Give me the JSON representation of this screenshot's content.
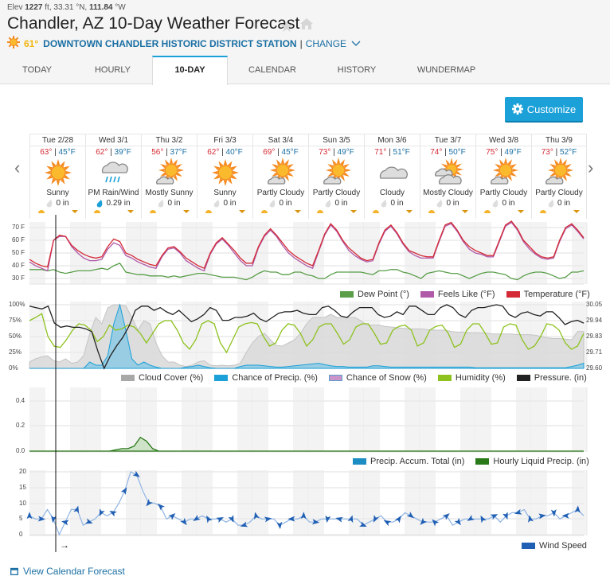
{
  "header": {
    "elev_label": "Elev",
    "elev_value": "1227",
    "elev_unit": "ft,",
    "lat": "33.31",
    "lat_unit": "°N,",
    "lon": "111.84",
    "lon_unit": "°W",
    "title": "Chandler, AZ 10-Day Weather Forecast",
    "current_temp": "61°",
    "station": "DOWNTOWN CHANDLER HISTORIC DISTRICT STATION",
    "separator": "|",
    "change_label": "CHANGE"
  },
  "tabs": [
    {
      "label": "TODAY",
      "active": false
    },
    {
      "label": "HOURLY",
      "active": false
    },
    {
      "label": "10-DAY",
      "active": true
    },
    {
      "label": "CALENDAR",
      "active": false
    },
    {
      "label": "HISTORY",
      "active": false
    },
    {
      "label": "WUNDERMAP",
      "active": false
    }
  ],
  "customize_label": "Customize",
  "days": [
    {
      "date": "Tue 2/28",
      "hi": "63°",
      "lo": "45°F",
      "icon": "sunny",
      "cond": "Sunny",
      "precip": "0 in",
      "rain": false
    },
    {
      "date": "Wed 3/1",
      "hi": "62°",
      "lo": "39°F",
      "icon": "rain",
      "cond": "PM Rain/Wind",
      "precip": "0.29 in",
      "rain": true
    },
    {
      "date": "Thu 3/2",
      "hi": "56°",
      "lo": "37°F",
      "icon": "mostly-sunny",
      "cond": "Mostly Sunny",
      "precip": "0 in",
      "rain": false
    },
    {
      "date": "Fri 3/3",
      "hi": "62°",
      "lo": "40°F",
      "icon": "sunny",
      "cond": "Sunny",
      "precip": "0 in",
      "rain": false
    },
    {
      "date": "Sat 3/4",
      "hi": "69°",
      "lo": "45°F",
      "icon": "partly-cloudy",
      "cond": "Partly Cloudy",
      "precip": "0 in",
      "rain": false
    },
    {
      "date": "Sun 3/5",
      "hi": "73°",
      "lo": "49°F",
      "icon": "partly-cloudy",
      "cond": "Partly Cloudy",
      "precip": "0 in",
      "rain": false
    },
    {
      "date": "Mon 3/6",
      "hi": "71°",
      "lo": "51°F",
      "icon": "cloudy",
      "cond": "Cloudy",
      "precip": "0 in",
      "rain": false
    },
    {
      "date": "Tue 3/7",
      "hi": "74°",
      "lo": "50°F",
      "icon": "mostly-cloudy",
      "cond": "Mostly Cloudy",
      "precip": "0 in",
      "rain": false
    },
    {
      "date": "Wed 3/8",
      "hi": "75°",
      "lo": "49°F",
      "icon": "partly-cloudy",
      "cond": "Partly Cloudy",
      "precip": "0 in",
      "rain": false
    },
    {
      "date": "Thu 3/9",
      "hi": "73°",
      "lo": "52°F",
      "icon": "partly-cloudy",
      "cond": "Partly Cloudy",
      "precip": "0 in",
      "rain": false
    }
  ],
  "colors": {
    "accent": "#1ba0d8",
    "link": "#1a6fa3",
    "temperature": "#d42a36",
    "feels_like": "#b05aa8",
    "dew_point": "#5a9e4a",
    "cloud_cover": "#a8a8a8",
    "precip_chance": "#1ba0d8",
    "snow_chance": "#c994c7",
    "humidity": "#8dc21f",
    "pressure": "#222222",
    "precip_accum": "#1b8dc2",
    "hourly_precip": "#2a7a1a",
    "wind": "#1f5fb4"
  },
  "chart_data": [
    {
      "type": "line",
      "name": "temperature-chart",
      "y_ticks": [
        "70 F",
        "60 F",
        "50 F",
        "40 F",
        "30 F"
      ],
      "ylim": [
        27,
        72
      ],
      "x_days": 10,
      "series": [
        {
          "name": "Temperature (°F)",
          "values": [
            45,
            42,
            40,
            39,
            60,
            64,
            63,
            56,
            52,
            49,
            47,
            46,
            47,
            55,
            61,
            59,
            50,
            48,
            45,
            43,
            41,
            40,
            48,
            54,
            55,
            51,
            46,
            43,
            40,
            38,
            50,
            58,
            62,
            57,
            52,
            46,
            42,
            42,
            55,
            64,
            69,
            64,
            58,
            52,
            48,
            45,
            42,
            40,
            52,
            65,
            73,
            68,
            60,
            54,
            50,
            46,
            44,
            45,
            58,
            68,
            72,
            66,
            58,
            52,
            50,
            48,
            47,
            47,
            60,
            72,
            74,
            68,
            60,
            55,
            52,
            50,
            48,
            48,
            60,
            72,
            75,
            69,
            60,
            55,
            50,
            47,
            46,
            47,
            60,
            70,
            73,
            68,
            62
          ]
        },
        {
          "name": "Feels Like (°F)",
          "values": [
            43,
            40,
            38,
            36,
            60,
            63,
            63,
            55,
            50,
            46,
            44,
            44,
            45,
            53,
            58,
            56,
            48,
            46,
            43,
            41,
            39,
            38,
            47,
            53,
            54,
            50,
            44,
            41,
            38,
            36,
            49,
            57,
            61,
            56,
            50,
            44,
            40,
            40,
            54,
            63,
            68,
            63,
            56,
            50,
            46,
            43,
            40,
            38,
            51,
            64,
            72,
            67,
            59,
            52,
            48,
            45,
            43,
            44,
            57,
            67,
            71,
            65,
            57,
            51,
            48,
            46,
            46,
            46,
            59,
            71,
            73,
            67,
            59,
            53,
            50,
            49,
            47,
            47,
            59,
            71,
            74,
            68,
            59,
            53,
            49,
            46,
            45,
            46,
            59,
            69,
            72,
            67,
            61
          ]
        },
        {
          "name": "Dew Point (°)",
          "values": [
            37,
            37,
            37,
            36,
            37,
            35,
            34,
            35,
            36,
            36,
            36,
            37,
            38,
            37,
            40,
            42,
            35,
            34,
            33,
            33,
            32,
            32,
            32,
            31,
            32,
            31,
            32,
            33,
            34,
            34,
            33,
            32,
            31,
            31,
            31,
            30,
            29,
            31,
            34,
            36,
            35,
            35,
            33,
            33,
            35,
            35,
            33,
            32,
            30,
            30,
            33,
            35,
            35,
            35,
            35,
            35,
            34,
            33,
            36,
            36,
            37,
            37,
            35,
            34,
            32,
            30,
            34,
            35,
            36,
            35,
            34,
            34,
            32,
            30,
            32,
            34,
            35,
            35,
            34,
            33,
            30,
            29,
            32,
            34,
            35,
            35,
            34,
            32,
            30,
            31,
            35,
            35,
            36
          ]
        }
      ],
      "legend": [
        "Dew Point (°)",
        "Feels Like (°F)",
        "Temperature (°F)"
      ],
      "legend_placement": "bottom-right"
    },
    {
      "type": "area",
      "name": "humidity-chart",
      "y_ticks_left": [
        "100%",
        "75%",
        "50%",
        "25%",
        "0%"
      ],
      "y_ticks_right": [
        "30.05",
        "29.94",
        "29.83",
        "29.71",
        "29.60"
      ],
      "ylim_left": [
        0,
        100
      ],
      "ylim_right": [
        29.6,
        30.05
      ],
      "series": [
        {
          "name": "Cloud Cover (%)",
          "values": [
            10,
            15,
            18,
            20,
            12,
            10,
            15,
            8,
            10,
            20,
            55,
            80,
            70,
            95,
            100,
            100,
            98,
            80,
            60,
            75,
            70,
            40,
            20,
            10,
            10,
            5,
            3,
            5,
            10,
            12,
            5,
            4,
            5,
            4,
            5,
            8,
            25,
            40,
            50,
            55,
            45,
            36,
            35,
            40,
            45,
            55,
            70,
            80,
            80,
            80,
            85,
            80,
            80,
            80,
            80,
            75,
            68,
            68,
            68,
            66,
            65,
            64,
            63,
            62,
            62,
            62,
            61,
            60,
            60,
            60,
            58,
            57,
            57,
            56,
            56,
            56,
            55,
            54,
            54,
            54,
            54,
            53,
            53,
            53,
            52,
            50,
            48,
            47,
            47,
            46,
            45,
            58,
            58
          ]
        },
        {
          "name": "Chance of Precip. (%)",
          "values": [
            0,
            0,
            0,
            0,
            0,
            0,
            0,
            0,
            0,
            0,
            10,
            5,
            5,
            20,
            70,
            100,
            60,
            15,
            5,
            10,
            5,
            2,
            0,
            0,
            0,
            0,
            2,
            3,
            5,
            3,
            1,
            0,
            0,
            0,
            0,
            3,
            5,
            5,
            5,
            4,
            3,
            2,
            2,
            3,
            4,
            5,
            6,
            7,
            8,
            6,
            4,
            3,
            3,
            2,
            2,
            2,
            2,
            4,
            4,
            3,
            2,
            2,
            2,
            2,
            2,
            2,
            2,
            2,
            2,
            2,
            2,
            2,
            2,
            2,
            1,
            1,
            1,
            1,
            1,
            1,
            1,
            1,
            1,
            1,
            1,
            1,
            1,
            1,
            1,
            1,
            3,
            5,
            8
          ]
        },
        {
          "name": "Chance of Snow (%)",
          "values": []
        },
        {
          "name": "Humidity (%)",
          "values": [
            75,
            80,
            86,
            50,
            35,
            33,
            45,
            60,
            70,
            68,
            60,
            42,
            50,
            68,
            60,
            62,
            68,
            65,
            55,
            40,
            55,
            70,
            75,
            75,
            60,
            40,
            30,
            45,
            70,
            75,
            70,
            40,
            25,
            45,
            65,
            70,
            72,
            70,
            50,
            35,
            40,
            60,
            70,
            68,
            55,
            35,
            45,
            65,
            70,
            70,
            55,
            38,
            45,
            65,
            70,
            70,
            55,
            38,
            40,
            60,
            66,
            68,
            60,
            35,
            40,
            60,
            66,
            68,
            55,
            33,
            38,
            60,
            70,
            70,
            55,
            38,
            40,
            65,
            70,
            68,
            45,
            30,
            35,
            50,
            70,
            68,
            60,
            40,
            30,
            35,
            55
          ]
        },
        {
          "name": "Pressure. (in)",
          "values": [
            30.04,
            30.03,
            30.02,
            30.04,
            29.92,
            29.89,
            29.9,
            29.89,
            29.89,
            29.88,
            29.86,
            29.72,
            29.6,
            29.69,
            29.76,
            29.82,
            29.9,
            30.01,
            30.04,
            30.04,
            30.01,
            30.03,
            30.0,
            29.98,
            30.01,
            29.97,
            29.93,
            29.95,
            29.98,
            30.03,
            30.01,
            29.94,
            29.94,
            29.96,
            29.96,
            29.97,
            29.99,
            29.95,
            29.93,
            29.96,
            29.99,
            30.0,
            30.0,
            30.01,
            29.99,
            29.98,
            29.98,
            30.03,
            30.04,
            30.01,
            29.97,
            29.96,
            30.0,
            30.03,
            30.03,
            30.03,
            29.98,
            29.96,
            29.97,
            30.0,
            29.98,
            30.04,
            30.04,
            30.01,
            29.98,
            29.98,
            30.03,
            30.05,
            30.03,
            29.98,
            29.96,
            30.01,
            30.03,
            30.03,
            30.04,
            30.05,
            30.04,
            29.98,
            29.96,
            29.99,
            30.0,
            29.98,
            29.97,
            30.0,
            30.0,
            29.96,
            29.91,
            29.93,
            29.94,
            29.92
          ]
        }
      ],
      "legend": [
        "Cloud Cover (%)",
        "Chance of Precip. (%)",
        "Chance of Snow (%)",
        "Humidity (%)",
        "Pressure. (in)"
      ],
      "legend_placement": "bottom-right"
    },
    {
      "type": "area",
      "name": "precip-chart",
      "y_ticks": [
        "0.4",
        "0.2",
        "0.0"
      ],
      "ylim": [
        0,
        0.5
      ],
      "series": [
        {
          "name": "Precip. Accum. Total (in)",
          "values": []
        },
        {
          "name": "Hourly Liquid Precip. (in)",
          "values": [
            0,
            0,
            0,
            0,
            0,
            0,
            0,
            0,
            0,
            0,
            0,
            0,
            0,
            0,
            0.01,
            0.02,
            0.02,
            0.04,
            0.11,
            0.08,
            0.02,
            0,
            0,
            0,
            0,
            0,
            0,
            0,
            0,
            0,
            0,
            0,
            0,
            0,
            0,
            0,
            0,
            0,
            0,
            0,
            0,
            0,
            0,
            0,
            0,
            0,
            0,
            0,
            0,
            0,
            0,
            0,
            0,
            0,
            0,
            0,
            0,
            0,
            0,
            0,
            0,
            0,
            0,
            0,
            0,
            0,
            0,
            0,
            0,
            0,
            0,
            0,
            0,
            0,
            0,
            0,
            0,
            0,
            0,
            0,
            0,
            0,
            0,
            0,
            0,
            0,
            0,
            0,
            0,
            0,
            0
          ]
        }
      ],
      "legend": [
        "Precip. Accum. Total (in)",
        "Hourly Liquid Precip. (in)"
      ],
      "legend_placement": "bottom-right"
    },
    {
      "type": "line",
      "name": "wind-chart",
      "y_ticks": [
        "20",
        "15",
        "10",
        "5",
        "0"
      ],
      "ylim": [
        0,
        20
      ],
      "series": [
        {
          "name": "Wind Speed",
          "values": [
            6,
            5,
            5,
            8,
            5,
            0,
            4,
            8,
            8,
            3,
            4,
            5,
            7,
            6,
            7,
            10,
            14,
            20,
            19,
            14,
            10,
            10,
            9,
            5,
            6,
            5,
            4,
            5,
            5,
            6,
            5,
            5,
            5,
            4,
            5,
            3,
            3,
            4,
            6,
            5,
            5,
            5,
            3,
            4,
            5,
            5,
            6,
            4,
            4,
            5,
            5,
            5,
            5,
            5,
            5,
            5,
            3,
            4,
            5,
            6,
            4,
            4,
            5,
            7,
            6,
            5,
            4,
            4,
            4,
            5,
            6,
            3,
            4,
            5,
            5,
            5,
            5,
            5,
            6,
            4,
            6,
            7,
            7,
            8,
            5,
            5,
            6,
            6,
            7,
            5,
            6,
            7,
            8,
            6
          ]
        }
      ],
      "legend": [
        "Wind Speed"
      ],
      "legend_placement": "bottom-right",
      "current_wind_arrow": "→"
    }
  ],
  "footer": {
    "calendar_link": "View Calendar Forecast"
  }
}
